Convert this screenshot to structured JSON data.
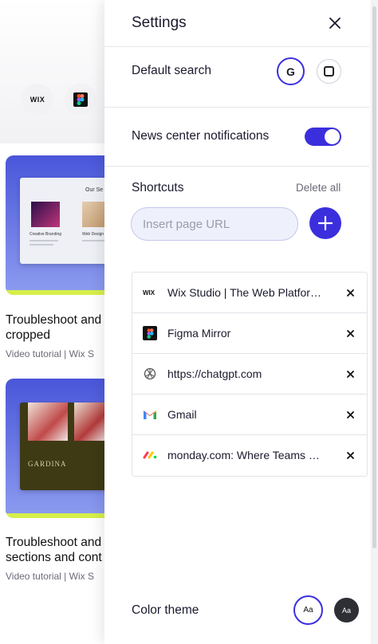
{
  "background": {
    "chips": [
      {
        "icon": "wix-logo-icon",
        "text": "WIX"
      },
      {
        "icon": "figma-logo-icon",
        "text": ""
      }
    ],
    "card1": {
      "heading": "Our Se",
      "tile_label_1": "Creative Branding",
      "tile_label_2": "Web Design"
    },
    "card2": {
      "heading": "GARDINA"
    },
    "articles": [
      {
        "title_line1": "Troubleshoot and",
        "title_line2": "cropped",
        "meta": "Video tutorial  |   Wix S"
      },
      {
        "title_line1": "Troubleshoot and",
        "title_line2": "sections and cont",
        "meta": "Video tutorial  |   Wix S"
      }
    ]
  },
  "settings": {
    "title": "Settings",
    "default_search": {
      "label": "Default search",
      "engines": [
        {
          "name": "google",
          "glyph": "G",
          "selected": true
        },
        {
          "name": "bing",
          "glyph": "",
          "selected": false
        }
      ]
    },
    "news_center": {
      "label": "News center notifications",
      "enabled": true
    },
    "shortcuts": {
      "label": "Shortcuts",
      "delete_all": "Delete all",
      "input_value": "",
      "input_placeholder": "Insert page URL",
      "items": [
        {
          "icon": "wix-logo-icon",
          "label": "Wix Studio | The Web Platform for Agencies"
        },
        {
          "icon": "figma-logo-icon",
          "label": "Figma Mirror"
        },
        {
          "icon": "openai-logo-icon",
          "label": "https://chatgpt.com"
        },
        {
          "icon": "gmail-logo-icon",
          "label": "Gmail"
        },
        {
          "icon": "monday-logo-icon",
          "label": "monday.com: Where Teams Get Work Done"
        }
      ]
    },
    "color_theme": {
      "label": "Color theme",
      "options": [
        {
          "name": "light",
          "text": "Aa",
          "selected": true
        },
        {
          "name": "dark",
          "text": "Aa",
          "selected": false
        }
      ]
    }
  },
  "colors": {
    "accent": "#3b2fdd",
    "lime": "#d6ef4a"
  }
}
